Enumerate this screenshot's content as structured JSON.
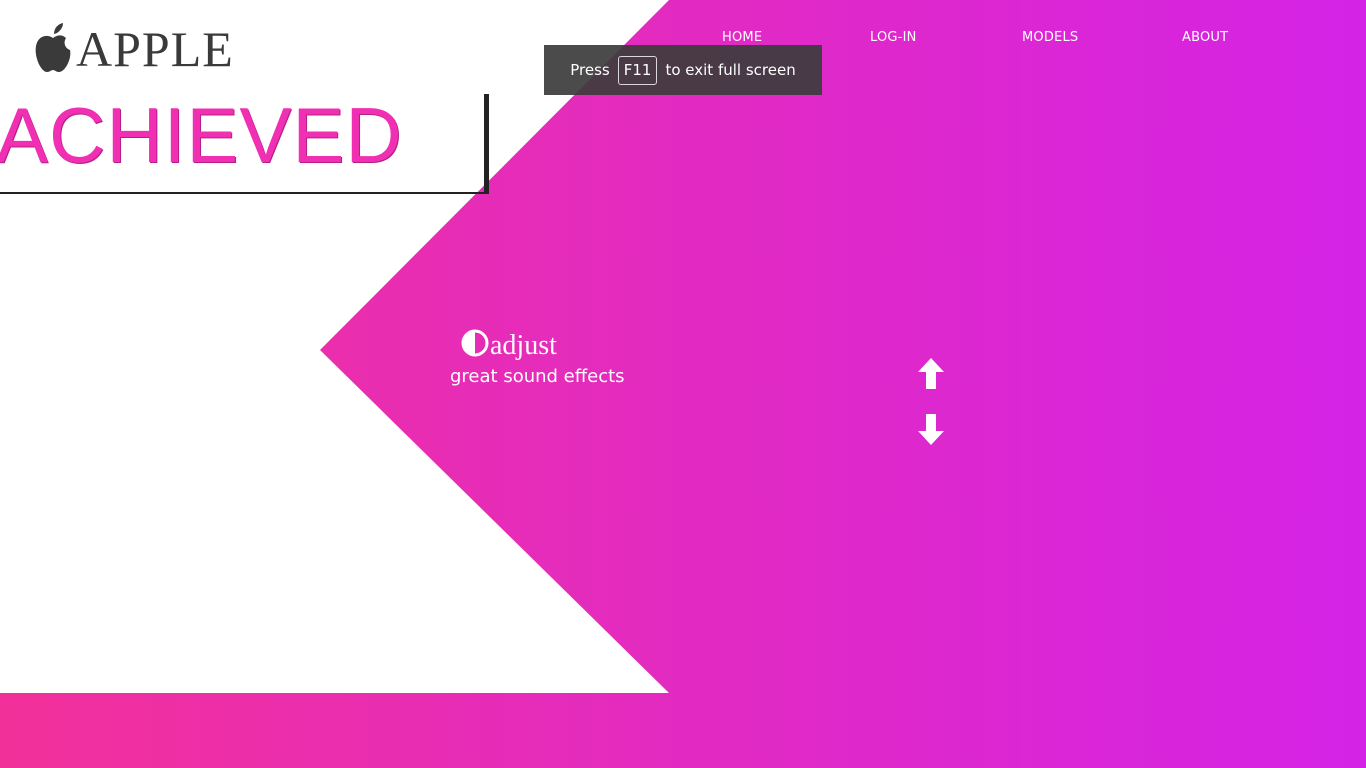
{
  "brand": {
    "name": "APPLE",
    "icon": "apple-logo-icon",
    "text_color": "#3a3a3a"
  },
  "nav": {
    "items": [
      {
        "label": "HOME"
      },
      {
        "label": "LOG-IN"
      },
      {
        "label": "MODELS"
      },
      {
        "label": "ABOUT"
      }
    ]
  },
  "fullscreen_toast": {
    "prefix": "Press",
    "key": "F11",
    "suffix": "to exit full screen"
  },
  "headline": {
    "text": "ACHIEVED",
    "color": "#f02fb3"
  },
  "feature": {
    "icon": "contrast-adjust-icon",
    "title": "adjust",
    "subtitle": "great sound effects"
  },
  "controls": {
    "up_icon": "arrow-up-icon",
    "down_icon": "arrow-down-icon"
  },
  "theme": {
    "gradient_start": "#f2309a",
    "gradient_end": "#d423e6"
  }
}
